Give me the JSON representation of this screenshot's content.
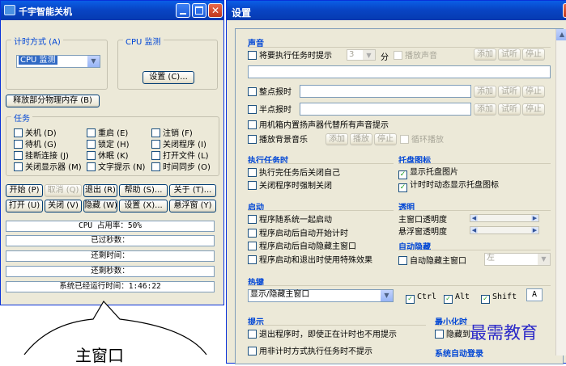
{
  "main_window": {
    "title": "千宇智能关机",
    "timing_mode_label": "计时方式 (A)",
    "timing_mode_value": "CPU 监测",
    "cpu_monitor_label": "CPU 监测",
    "settings_button": "设置 (C)...",
    "release_memory_button": "释放部分物理内存 (B)",
    "tasks_label": "任务",
    "tasks": [
      [
        "关机 (D)",
        "重启 (E)",
        "注销 (F)"
      ],
      [
        "待机 (G)",
        "锁定 (H)",
        "关闭程序 (I)"
      ],
      [
        "挂断连接 (J)",
        "休眠 (K)",
        "打开文件 (L)"
      ],
      [
        "关闭显示器 (M)",
        "文字提示 (N)",
        "时间同步 (O)"
      ]
    ],
    "buttons_row1": [
      "开始 (P)",
      "取消 (Q)",
      "退出 (R)",
      "帮助 (S)...",
      "关于 (T)..."
    ],
    "buttons_row2": [
      "打开 (U)",
      "关闭 (V)",
      "隐藏 (W)",
      "设置 (X)...",
      "悬浮窗 (Y)"
    ],
    "cpu_usage": "CPU 占用率：50%",
    "elapsed_seconds": "已过秒数：",
    "remaining_time": "还剩时间：",
    "remaining_seconds": "还剩秒数：",
    "system_uptime": "系统已经运行时间：1:46:22"
  },
  "callout_text": "主窗口",
  "watermark": "最需教育",
  "settings_window": {
    "title": "设置",
    "sound": {
      "label": "声音",
      "notify_before": "将要执行任务时提示",
      "minutes_value": "3",
      "minutes_unit": "分",
      "play_sound": "播放声音",
      "hourly_chime": "整点报时",
      "half_hour_chime": "半点报时",
      "pc_speaker": "用机箱内置扬声器代替所有声音提示",
      "bg_music": "播放背景音乐",
      "bg_add": "添加",
      "bg_play": "播放",
      "bg_stop": "停止",
      "loop_play": "循环播放",
      "add": "添加",
      "preview": "试听",
      "stop": "停止"
    },
    "execute_task": {
      "label": "执行任务时",
      "close_self": "执行完任务后关闭自己",
      "force_close": "关闭程序时强制关闭"
    },
    "tray_icon": {
      "label": "托盘图标",
      "show_tray": "显示托盘图片",
      "dynamic_tray": "计时时动态显示托盘图标"
    },
    "startup": {
      "label": "启动",
      "with_system": "程序随系统一起启动",
      "auto_timing": "程序启动后自动开始计时",
      "auto_hide": "程序启动后自动隐藏主窗口",
      "special_effects": "程序启动和退出时使用特殊效果"
    },
    "transparency": {
      "label": "透明",
      "main_window": "主窗口透明度",
      "float_window": "悬浮窗透明度"
    },
    "auto_hide": {
      "label": "自动隐藏",
      "auto_hide_main": "自动隐藏主窗口",
      "position_value": "左"
    },
    "hotkey": {
      "label": "热键",
      "action_value": "显示/隐藏主窗口",
      "ctrl": "Ctrl",
      "alt": "Alt",
      "shift": "Shift",
      "key": "A"
    },
    "prompt": {
      "label": "提示",
      "exit_no_prompt": "退出程序时，即使正在计时也不用提示",
      "non_timing_no_prompt": "用非计时方式执行任务时不提示"
    },
    "minimize": {
      "label": "最小化时",
      "hide": "隐藏到"
    },
    "sys_auto_login": {
      "label": "系统自动登录"
    }
  }
}
